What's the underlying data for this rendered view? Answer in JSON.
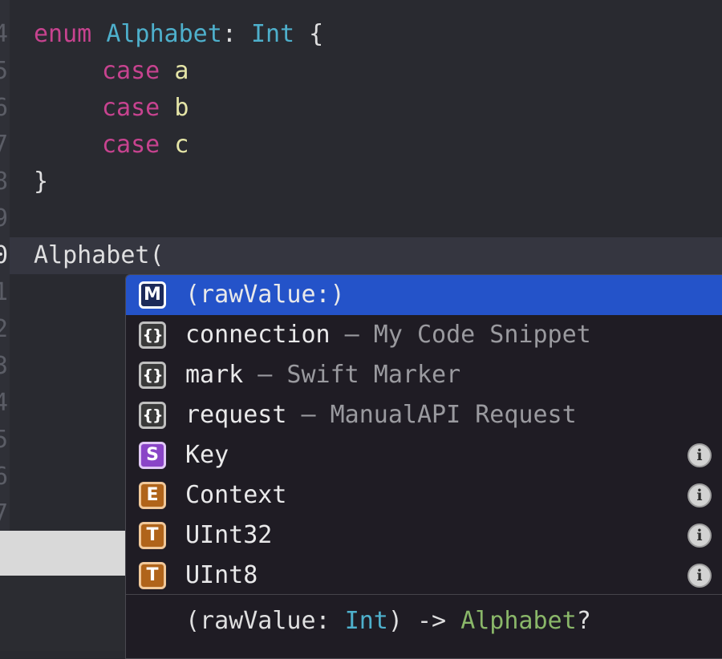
{
  "gutter": {
    "line_numbers": [
      "4",
      "5",
      "6",
      "7",
      "8",
      "9",
      "0",
      "1",
      "2",
      "3",
      "4",
      "5",
      "6",
      "7"
    ]
  },
  "code": {
    "lines": [
      {
        "kw": "enum",
        "type": "Alphabet",
        "rest1": ": ",
        "type2": "Int",
        "rest2": " {"
      },
      {
        "kw": "case",
        "ident": "a"
      },
      {
        "kw": "case",
        "ident": "b"
      },
      {
        "kw": "case",
        "ident": "c"
      },
      {
        "text": "}"
      },
      {
        "text": ""
      },
      {
        "text": "Alphabet("
      }
    ]
  },
  "autocomplete": {
    "items": [
      {
        "badge": "M",
        "kind": "method",
        "label": "(rawValue:)",
        "sub": "",
        "info": false,
        "selected": true
      },
      {
        "badge": "{}",
        "kind": "snippet",
        "label": "connection",
        "sub": " – My Code Snippet",
        "info": false,
        "selected": false
      },
      {
        "badge": "{}",
        "kind": "snippet",
        "label": "mark",
        "sub": " – Swift Marker",
        "info": false,
        "selected": false
      },
      {
        "badge": "{}",
        "kind": "snippet",
        "label": "request",
        "sub": " – ManualAPI Request",
        "info": false,
        "selected": false
      },
      {
        "badge": "S",
        "kind": "struct",
        "label": "Key",
        "sub": "",
        "info": true,
        "selected": false
      },
      {
        "badge": "E",
        "kind": "enum",
        "label": "Context",
        "sub": "",
        "info": true,
        "selected": false
      },
      {
        "badge": "T",
        "kind": "typealias",
        "label": "UInt32",
        "sub": "",
        "info": true,
        "selected": false
      },
      {
        "badge": "T",
        "kind": "typealias",
        "label": "UInt8",
        "sub": "",
        "info": true,
        "selected": false
      }
    ],
    "info_glyph": "i",
    "signature": {
      "p1": "(rawValue: ",
      "int": "Int",
      "p2": ") -> ",
      "alpha": "Alphabet",
      "p3": "?"
    }
  },
  "colors": {
    "background": "#292a30",
    "keyword": "#c7438f",
    "type": "#4eb0cc",
    "identifier": "#e5e5a7",
    "selection": "#2453c9",
    "popup_bg": "#1f1c24"
  }
}
